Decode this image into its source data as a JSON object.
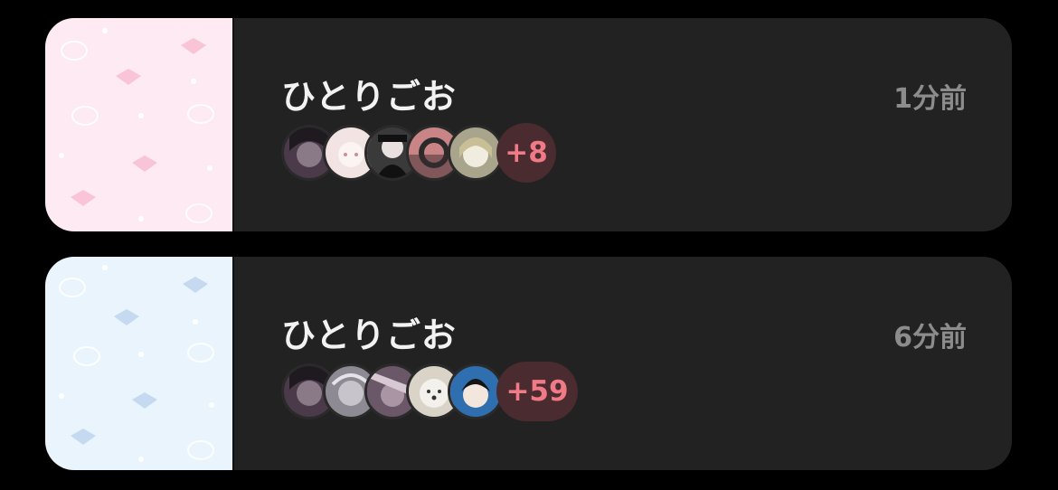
{
  "cards": [
    {
      "title": "ひとりごお",
      "time": "1分前",
      "more_count": "+8",
      "thumbnail_bg": "#fdeaf2",
      "thumbnail_accent": "#f7b8cc",
      "avatars": [
        {
          "name": "avatar-dark-girl",
          "bg": "#4b3a4a"
        },
        {
          "name": "avatar-pale-girl",
          "bg": "#f1e4e2"
        },
        {
          "name": "avatar-black-outfit",
          "bg": "#3a3a3a"
        },
        {
          "name": "avatar-pink-ring",
          "bg": "#c98585"
        },
        {
          "name": "avatar-blonde-girl",
          "bg": "#a9a48c"
        }
      ]
    },
    {
      "title": "ひとりごお",
      "time": "6分前",
      "more_count": "+59",
      "thumbnail_bg": "#eaf4fc",
      "thumbnail_accent": "#bcd3ee",
      "avatars": [
        {
          "name": "avatar-dark-girl",
          "bg": "#4b3a4a"
        },
        {
          "name": "avatar-grey-sketch",
          "bg": "#8d8a93"
        },
        {
          "name": "avatar-purple-girl",
          "bg": "#6a5868"
        },
        {
          "name": "avatar-white-dog",
          "bg": "#d9d3c8"
        },
        {
          "name": "avatar-blue-boy",
          "bg": "#2f6fb0"
        }
      ]
    }
  ]
}
